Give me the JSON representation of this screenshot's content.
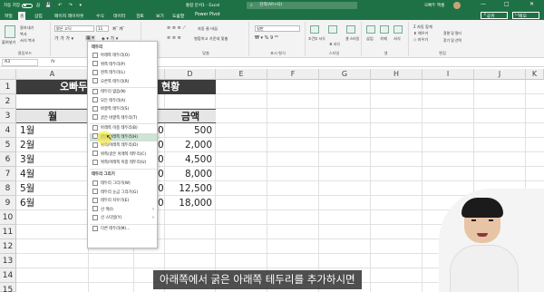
{
  "titlebar": {
    "autosave": "자동 저장",
    "autosave_state": "끔",
    "doc_name": "통합 문서1 - Excel",
    "search_placeholder": "검색(Alt+Q)",
    "user_name": "오빠두 엑셀",
    "window_controls": [
      "—",
      "□",
      "✕"
    ]
  },
  "tabs": [
    "파일",
    "홈",
    "삽입",
    "페이지 레이아웃",
    "수식",
    "데이터",
    "검토",
    "보기",
    "도움말",
    "Power Pivot"
  ],
  "active_tab": "홈",
  "share_label": "공유",
  "comment_label": "메모",
  "ribbon": {
    "clipboard": {
      "paste": "붙여넣기",
      "cut": "잘라내기",
      "copy": "복사",
      "format_painter": "서식 복사",
      "group": "클립보드"
    },
    "font": {
      "name": "맑은 고딕",
      "size": "11",
      "group": "글꼴"
    },
    "alignment": {
      "wrap": "자동 줄 바꿈",
      "merge": "병합하고 가운데 맞춤",
      "group": "맞춤"
    },
    "number": {
      "format": "일반",
      "group": "표시 형식"
    },
    "styles": {
      "conditional": "조건부 서식",
      "table": "표 서식",
      "cell": "셀 스타일",
      "group": "스타일"
    },
    "cells": {
      "insert": "삽입",
      "delete": "삭제",
      "format": "서식",
      "group": "셀"
    },
    "editing": {
      "autosum": "자동 합계",
      "fill": "채우기",
      "clear": "지우기",
      "sort": "정렬 및 필터",
      "find": "찾기 및 선택",
      "group": "편집"
    }
  },
  "formula_bar": {
    "name_box": "A3",
    "fx": "fx"
  },
  "columns": [
    "A",
    "B",
    "C",
    "D",
    "E",
    "F",
    "G",
    "H",
    "I",
    "J",
    "K"
  ],
  "rows": [
    "1",
    "2",
    "3",
    "4",
    "5",
    "6",
    "7",
    "8",
    "9",
    "10",
    "11",
    "12",
    "13",
    "14",
    "15"
  ],
  "sheet": {
    "banner_left": "오빠두",
    "banner_right": "현황",
    "header_month": "월",
    "header_amount": "금액",
    "months": [
      "1월",
      "2월",
      "3월",
      "4월",
      "5월",
      "6월"
    ],
    "col_c": [
      "0",
      "0",
      "0",
      "0",
      "0",
      "0"
    ],
    "amounts": [
      "500",
      "2,000",
      "4,500",
      "8,000",
      "12,500",
      "18,000"
    ]
  },
  "border_menu": {
    "section_borders": "테두리",
    "items": [
      "아래쪽 테두리(O)",
      "위쪽 테두리(P)",
      "왼쪽 테두리(L)",
      "오른쪽 테두리(R)",
      "테두리 없음(N)",
      "모든 테두리(A)",
      "바깥쪽 테두리(S)",
      "굵은 바깥쪽 테두리(T)",
      "아래쪽 이중 테두리(B)",
      "굵은 아래쪽 테두리(H)",
      "위쪽/아래쪽 테두리(D)",
      "위쪽/굵은 아래쪽 테두리(C)",
      "위쪽/아래쪽 이중 테두리(U)"
    ],
    "highlighted_index": 9,
    "section_draw": "테두리 그리기",
    "draw_items": [
      "테두리 그리기(W)",
      "테두리 눈금 그리기(G)",
      "테두리 지우기(E)",
      "선 색(I)",
      "선 스타일(Y)",
      "다른 테두리(M)..."
    ]
  },
  "subtitle": "아래쪽에서 굵은 아래쪽 테두리를 추가하시면",
  "colors": {
    "excel_green": "#1e7145",
    "banner": "#3b3b3b",
    "menu_highlight": "#cfe3d6"
  }
}
